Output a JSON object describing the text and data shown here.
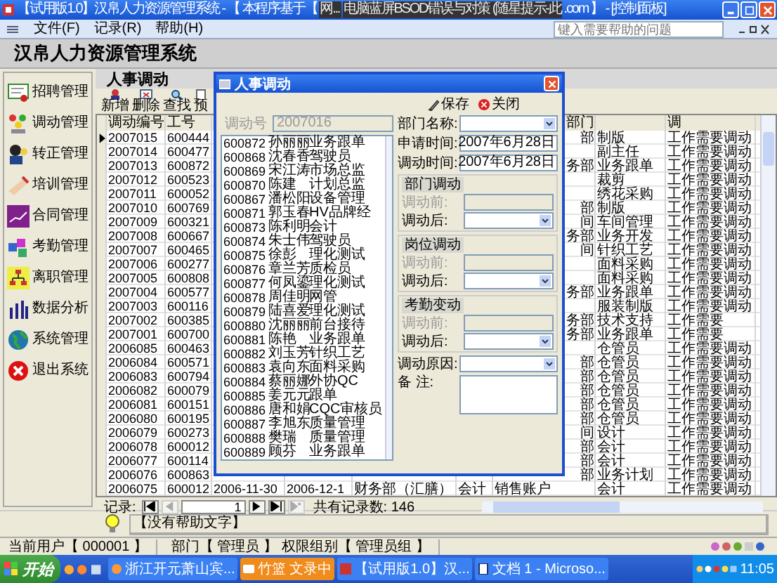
{
  "window": {
    "title": "【试用版1.0】汉帛人力资源管理系统 - 【 本程序基于【",
    "title_tail": ".com 】 - [控制面板]"
  },
  "popups": [
    {
      "label": "网..."
    },
    {
      "label": "电脑蓝屏BSOD错误与对策 (随星提示-此"
    }
  ],
  "menu": [
    "文件(F)",
    "记录(R)",
    "帮助(H)"
  ],
  "help_search": {
    "placeholder": "键入需要帮助的问题"
  },
  "app_title": "汉帛人力资源管理系统",
  "sidebar": {
    "items": [
      {
        "label": "招聘管理",
        "kind": "certificate"
      },
      {
        "label": "调动管理",
        "kind": "people"
      },
      {
        "label": "转正管理",
        "kind": "person"
      },
      {
        "label": "培训管理",
        "kind": "hand"
      },
      {
        "label": "合同管理",
        "kind": "chart"
      },
      {
        "label": "考勤管理",
        "kind": "cubes"
      },
      {
        "label": "离职管理",
        "kind": "org"
      },
      {
        "label": "数据分析",
        "kind": "bars"
      },
      {
        "label": "系统管理",
        "kind": "globe"
      },
      {
        "label": "退出系统",
        "kind": "exit"
      }
    ]
  },
  "section_title": "人事调动",
  "toolbar": [
    {
      "label": "新增",
      "kind": "add"
    },
    {
      "label": "删除",
      "kind": "delete"
    },
    {
      "label": "查找",
      "kind": "find"
    },
    {
      "label": "预",
      "kind": "preview"
    }
  ],
  "table": {
    "headers": {
      "id": "调动编号",
      "no": "工号",
      "dept_after": "部门",
      "reason": "调"
    },
    "rows": [
      {
        "selected": true,
        "id": "2007015",
        "no": "600444",
        "dept_after": "部",
        "post_after": "制版",
        "reason": "工作需要调动"
      },
      {
        "selected": false,
        "id": "2007014",
        "no": "600477",
        "post_after": "副主任",
        "reason": "工作需要调动"
      },
      {
        "selected": false,
        "id": "2007013",
        "no": "600872",
        "dept_after": "务部",
        "post_after": "业务跟单",
        "reason": "工作需要调动"
      },
      {
        "selected": false,
        "id": "2007012",
        "no": "600523",
        "post_after": "裁剪",
        "reason": "工作需要调动"
      },
      {
        "selected": false,
        "id": "2007011",
        "no": "600052",
        "post_after": "绣花采购",
        "reason": "工作需要调动"
      },
      {
        "selected": false,
        "id": "2007010",
        "no": "600769",
        "dept_after": "部",
        "post_after": "制版",
        "reason": "工作需要调动"
      },
      {
        "selected": false,
        "id": "2007009",
        "no": "600321",
        "dept_after": "间",
        "post_after": "车间管理",
        "reason": "工作需要调动"
      },
      {
        "selected": false,
        "id": "2007008",
        "no": "600667",
        "dept_after": "务部",
        "post_after": "业务开发",
        "reason": "工作需要调动"
      },
      {
        "selected": false,
        "id": "2007007",
        "no": "600465",
        "dept_after": "间",
        "post_after": "针织工艺",
        "reason": "工作需要调动"
      },
      {
        "selected": false,
        "id": "2007006",
        "no": "600277",
        "post_after": "面料采购",
        "reason": "工作需要调动"
      },
      {
        "selected": false,
        "id": "2007005",
        "no": "600808",
        "post_after": "面料采购",
        "reason": "工作需要调动"
      },
      {
        "selected": false,
        "id": "2007004",
        "no": "600577",
        "dept_after": "务部",
        "post_after": "业务跟单",
        "reason": "工作需要调动"
      },
      {
        "selected": false,
        "id": "2007003",
        "no": "600116",
        "post_after": "服装制版",
        "reason": "工作需要调动"
      },
      {
        "selected": false,
        "id": "2007002",
        "no": "600385",
        "dept_after": "务部",
        "post_after": "技术支持",
        "reason": "工作需要"
      },
      {
        "selected": false,
        "id": "2007001",
        "no": "600700",
        "dept_after": "务部",
        "post_after": "业务跟单",
        "reason": "工作需要"
      },
      {
        "selected": false,
        "id": "2006085",
        "no": "600463",
        "post_after": "仓管员",
        "reason": "工作需要调动"
      },
      {
        "selected": false,
        "id": "2006084",
        "no": "600571",
        "dept_after": "部",
        "post_after": "仓管员",
        "reason": "工作需要调动"
      },
      {
        "selected": false,
        "id": "2006083",
        "no": "600794",
        "dept_after": "部",
        "post_after": "仓管员",
        "reason": "工作需要调动"
      },
      {
        "selected": false,
        "id": "2006082",
        "no": "600079",
        "dept_after": "部",
        "post_after": "仓管员",
        "reason": "工作需要调动"
      },
      {
        "selected": false,
        "id": "2006081",
        "no": "600151",
        "dept_after": "部",
        "post_after": "仓管员",
        "reason": "工作需要调动"
      },
      {
        "selected": false,
        "id": "2006080",
        "no": "600195",
        "dept_after": "部",
        "post_after": "仓管员",
        "reason": "工作需要调动"
      },
      {
        "selected": false,
        "id": "2006079",
        "no": "600273",
        "dept_after": "间",
        "post_after": "设计",
        "reason": "工作需要调动"
      },
      {
        "selected": false,
        "id": "2006078",
        "no": "600012",
        "dept_after": "部",
        "post_after": "会计",
        "reason": "工作需要调动"
      },
      {
        "selected": false,
        "id": "2006077",
        "no": "600114",
        "dept_after": "部",
        "post_after": "会计",
        "reason": "工作需要调动"
      },
      {
        "selected": false,
        "id": "2006076",
        "no": "600863",
        "dept_after": "部",
        "post_after": "业务计划",
        "reason": "工作需要调动"
      },
      {
        "selected": false,
        "id": "2006075",
        "no": "600012",
        "date_apply": "2006-11-30",
        "date_move": "2006-12-1",
        "dept_before": "财务部（汇膳）",
        "post_before": "会计",
        "dept_after": "销售账户",
        "post_after": "会计",
        "reason": "工作需要调动"
      }
    ]
  },
  "dialog": {
    "title": "人事调动",
    "buttons": [
      {
        "label": "保存",
        "kind": "save"
      },
      {
        "label": "关闭",
        "kind": "close"
      }
    ],
    "id_label": "调动号",
    "id_value": "2007016",
    "list": [
      [
        "600872",
        "孙丽丽",
        "业务跟单"
      ],
      [
        "600868",
        "沈春香",
        "驾驶员"
      ],
      [
        "600869",
        "宋江涛",
        "市场总监"
      ],
      [
        "600870",
        "陈建",
        "计划总监"
      ],
      [
        "600867",
        "潘松阳",
        "设备管理"
      ],
      [
        "600871",
        "郭玉春",
        "HV品牌经"
      ],
      [
        "600873",
        "陈利明",
        "会计"
      ],
      [
        "600874",
        "朱士伟",
        "驾驶员"
      ],
      [
        "600875",
        "徐彭",
        "理化测试"
      ],
      [
        "600876",
        "章兰芳",
        "质检员"
      ],
      [
        "600877",
        "何凤鎏",
        "理化测试"
      ],
      [
        "600878",
        "周佳明",
        "网管"
      ],
      [
        "600879",
        "陆喜爱",
        "理化测试"
      ],
      [
        "600880",
        "沈丽丽",
        "前台接待"
      ],
      [
        "600881",
        "陈艳",
        "业务跟单"
      ],
      [
        "600882",
        "刘玉芳",
        "针织工艺"
      ],
      [
        "600883",
        "袁向东",
        "面料采购"
      ],
      [
        "600884",
        "蔡丽娜",
        "外协QC"
      ],
      [
        "600885",
        "姜元元",
        "跟单"
      ],
      [
        "600886",
        "唐和娟",
        "CQC审核员"
      ],
      [
        "600887",
        "李旭东",
        "质量管理"
      ],
      [
        "600888",
        "樊瑞",
        "质量管理"
      ],
      [
        "600889",
        "顾芬",
        "业务跟单"
      ]
    ],
    "fields": [
      {
        "kind": "select",
        "label": "部门名称:"
      },
      {
        "kind": "text",
        "label": "申请时间:",
        "value": "2007年6月28日"
      },
      {
        "kind": "text",
        "label": "调动时间:",
        "value": "2007年6月28日"
      },
      {
        "kind": "group",
        "title": "部门调动",
        "rows": [
          {
            "kind": "text",
            "label": "调动前:",
            "disabled": true
          },
          {
            "kind": "select",
            "label": "调动后:",
            "disabled": false
          }
        ]
      },
      {
        "kind": "group",
        "title": "岗位调动",
        "rows": [
          {
            "kind": "text",
            "label": "调动前:",
            "disabled": true
          },
          {
            "kind": "select",
            "label": "调动后:",
            "disabled": false
          }
        ]
      },
      {
        "kind": "group",
        "title": "考勤变动",
        "rows": [
          {
            "kind": "text",
            "label": "调动前:",
            "disabled": true
          },
          {
            "kind": "select",
            "label": "调动后:",
            "disabled": false
          }
        ]
      },
      {
        "kind": "select",
        "label": "调动原因:"
      },
      {
        "kind": "area",
        "label": "备  注:"
      }
    ]
  },
  "records": {
    "label": "记录:",
    "current": "1",
    "total": "共有记录数: 146",
    "nav": [
      {
        "kind": "first",
        "disabled": false
      },
      {
        "kind": "prev",
        "disabled": true
      },
      {
        "kind": "next",
        "disabled": false
      },
      {
        "kind": "last",
        "disabled": false
      },
      {
        "kind": "new",
        "disabled": true
      }
    ]
  },
  "help_text": "【没有帮助文字】",
  "status": [
    "当前用户【 000001 】",
    "部门【 管理员 】 权限组别【 管理员组 】"
  ],
  "taskbar": {
    "start": "开始",
    "tasks": [
      {
        "label": "浙江开元萧山宾...",
        "flashing": false,
        "kind": "browser"
      },
      {
        "label": "竹篮 文录中",
        "flashing": true,
        "kind": "chat"
      },
      {
        "label": "【试用版1.0】汉...",
        "flashing": false,
        "kind": "app"
      },
      {
        "label": "文档 1 - Microso...",
        "flashing": false,
        "kind": "doc"
      }
    ],
    "clock": "11:05"
  }
}
